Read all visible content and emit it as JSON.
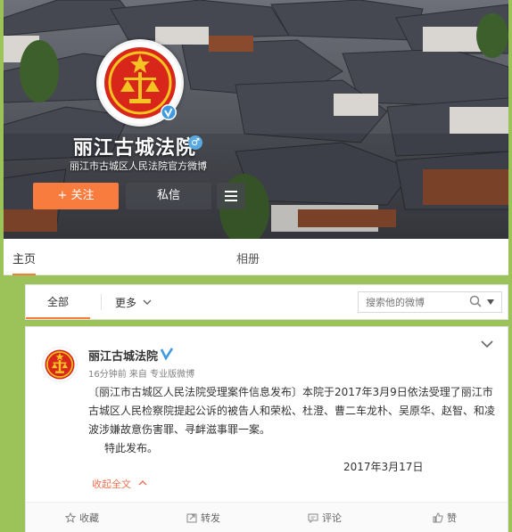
{
  "profile": {
    "name": "丽江古城法院",
    "description": "丽江市古城区人民法院官方微博",
    "follow_label": "+ 关注",
    "message_label": "私信"
  },
  "tabs": {
    "home": "主页",
    "album": "相册"
  },
  "filter": {
    "all": "全部",
    "more": "更多",
    "search_placeholder": "搜索他的微博"
  },
  "post": {
    "author": "丽江古城法院",
    "meta": "16分钟前 来自 专业版微博",
    "text": "〔丽江市古城区人民法院受理案件信息发布〕本院于2017年3月9日依法受理了丽江市古城区人民检察院提起公诉的被告人和荣松、杜澄、曹二车龙朴、吴原华、赵智、和凌波涉嫌故意伤害罪、寻衅滋事罪一案。",
    "text2": "特此发布。",
    "date": "2017年3月17日",
    "collapse": "收起全文",
    "actions": {
      "favorite": "收藏",
      "forward": "转发",
      "comment": "评论",
      "like": "赞"
    }
  },
  "colors": {
    "accent": "#f77c3d",
    "page_bg": "#9cc25a",
    "verify": "#3f9ae0",
    "emblem_red": "#d8261b",
    "emblem_gold": "#f5c322"
  },
  "icons": [
    "court-emblem-icon",
    "verified-icon",
    "gender-icon",
    "menu-icon",
    "chevron-down-icon",
    "search-icon",
    "star-icon",
    "forward-icon",
    "comment-icon",
    "like-icon"
  ]
}
